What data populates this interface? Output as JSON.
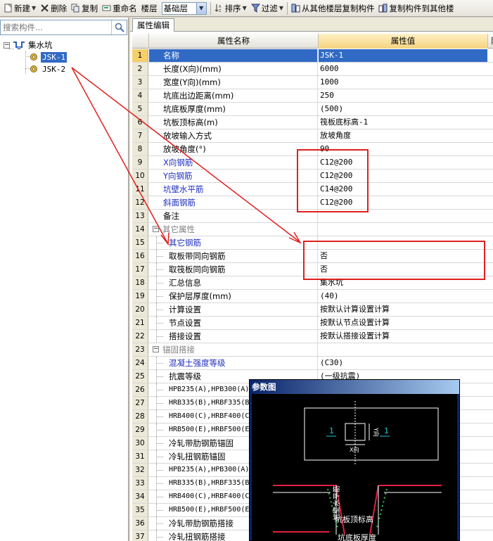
{
  "toolbar": {
    "new": "新建",
    "delete": "删除",
    "copy": "复制",
    "rename": "重命名",
    "floor_label": "楼层",
    "floor_value": "基础层",
    "sort": "排序",
    "filter": "过滤",
    "copy_from_floor": "从其他楼层复制构件",
    "copy_to_floor": "复制构件到其他楼"
  },
  "search": {
    "placeholder": "搜索构件..."
  },
  "tree": {
    "root": "集水坑",
    "children": [
      "JSK-1",
      "JSK-2"
    ]
  },
  "tab": "属性编辑",
  "grid": {
    "headers": [
      "属性名称",
      "属性值",
      "附"
    ],
    "rows": [
      {
        "n": "1",
        "name": "名称",
        "value": "JSK-1"
      },
      {
        "n": "2",
        "name": "长度(X向)(mm)",
        "value": "6000"
      },
      {
        "n": "3",
        "name": "宽度(Y向)(mm)",
        "value": "1000"
      },
      {
        "n": "4",
        "name": "坑底出边距离(mm)",
        "value": "250"
      },
      {
        "n": "5",
        "name": "坑底板厚度(mm)",
        "value": "(500)"
      },
      {
        "n": "6",
        "name": "坑板顶标高(m)",
        "value": "筏板底标高-1"
      },
      {
        "n": "7",
        "name": "放坡输入方式",
        "value": "放坡角度"
      },
      {
        "n": "8",
        "name": "放坡角度(°)",
        "value": "90"
      },
      {
        "n": "9",
        "name": "X向钢筋",
        "value": "C12@200"
      },
      {
        "n": "10",
        "name": "Y向钢筋",
        "value": "C12@200"
      },
      {
        "n": "11",
        "name": "坑壁水平筋",
        "value": "C14@200"
      },
      {
        "n": "12",
        "name": "斜面钢筋",
        "value": "C12@200"
      },
      {
        "n": "13",
        "name": "备注",
        "value": ""
      },
      {
        "n": "14",
        "name": "其它属性",
        "value": ""
      },
      {
        "n": "15",
        "name": "其它钢筋",
        "value": ""
      },
      {
        "n": "16",
        "name": "取板带同向钢筋",
        "value": "否"
      },
      {
        "n": "17",
        "name": "取筏板同向钢筋",
        "value": "否"
      },
      {
        "n": "18",
        "name": "汇总信息",
        "value": "集水坑"
      },
      {
        "n": "19",
        "name": "保护层厚度(mm)",
        "value": "(40)"
      },
      {
        "n": "20",
        "name": "计算设置",
        "value": "按默认计算设置计算"
      },
      {
        "n": "21",
        "name": "节点设置",
        "value": "按默认节点设置计算"
      },
      {
        "n": "22",
        "name": "搭接设置",
        "value": "按默认搭接设置计算"
      },
      {
        "n": "23",
        "name": "锚固搭接",
        "value": ""
      },
      {
        "n": "24",
        "name": "混凝土强度等级",
        "value": "(C30)"
      },
      {
        "n": "25",
        "name": "抗震等级",
        "value": "(一级抗震)"
      },
      {
        "n": "26",
        "name": "HPB235(A),HPB300(A)",
        "value": ""
      },
      {
        "n": "27",
        "name": "HRB335(B),HRBF335(B)",
        "value": ""
      },
      {
        "n": "28",
        "name": "HRB400(C),HRBF400(C)",
        "value": ""
      },
      {
        "n": "29",
        "name": "HRB500(E),HRBF500(E)",
        "value": ""
      },
      {
        "n": "30",
        "name": "冷轧带肋钢筋锚固",
        "value": ""
      },
      {
        "n": "31",
        "name": "冷轧扭钢筋锚固",
        "value": ""
      },
      {
        "n": "32",
        "name": "HPB235(A),HPB300(A)",
        "value": ""
      },
      {
        "n": "33",
        "name": "HRB335(B),HRBF335(B)",
        "value": ""
      },
      {
        "n": "34",
        "name": "HRB400(C),HRBF400(C)",
        "value": ""
      },
      {
        "n": "35",
        "name": "HRB500(E),HRBF500(E)",
        "value": ""
      },
      {
        "n": "36",
        "name": "冷轧带肋钢筋搭接",
        "value": ""
      },
      {
        "n": "37",
        "name": "冷轧扭钢筋搭接",
        "value": ""
      }
    ]
  },
  "popup": {
    "title": "参数图",
    "marker": "1",
    "label_x": "X向",
    "label_y": "Y向",
    "label_wall": "坑壁水平筋",
    "label_top": "坑板顶标高",
    "label_bottom": "坑底板厚度"
  },
  "colors": {
    "selection": "#316ac5",
    "annotation": "#e02020",
    "blue_text": "#1f2fbf"
  }
}
